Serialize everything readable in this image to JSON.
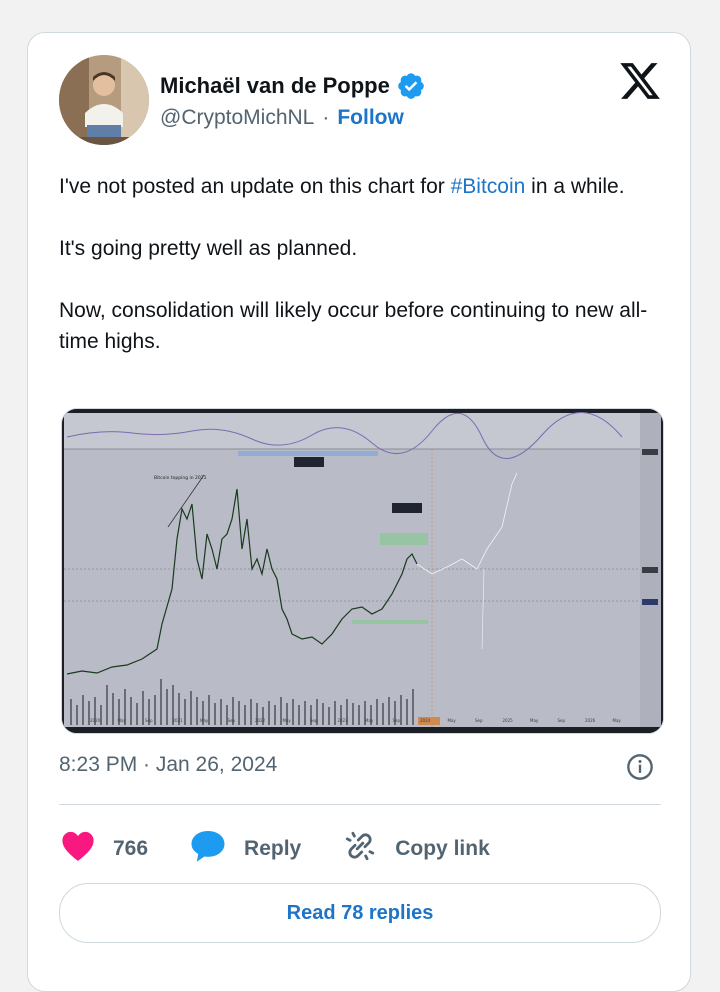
{
  "author": {
    "name": "Michaël van de Poppe",
    "handle": "@CryptoMichNL",
    "separator": "·",
    "follow_label": "Follow",
    "verified": true
  },
  "tweet": {
    "line1_prefix": "I've not posted an update on this chart for ",
    "hashtag": "#Bitcoin",
    "line1_suffix": " in a while.",
    "paragraph2": "It's going pretty well as planned.",
    "paragraph3": "Now, consolidation will likely occur before continuing to new all-time highs."
  },
  "timestamp": "8:23 PM · Jan 26, 2024",
  "actions": {
    "likes_count": "766",
    "reply_label": "Reply",
    "copy_link_label": "Copy link"
  },
  "read_replies_label": "Read 78 replies",
  "icons": {
    "brand": "x-logo-icon",
    "verified": "verified-badge-icon",
    "info": "info-icon",
    "like": "heart-icon",
    "reply": "reply-bubble-icon",
    "copy": "link-icon"
  },
  "colors": {
    "link": "#1d75c7",
    "like": "#f91880",
    "reply_icon": "#1d9bf0",
    "muted": "#536471",
    "text": "#0f1419"
  },
  "chart_image": {
    "annotation": "Bitcoin topping in 2021",
    "x_labels": [
      "2020",
      "May",
      "Sep",
      "2021",
      "May",
      "Sep",
      "2022",
      "May",
      "Sep",
      "2023",
      "May",
      "Sep",
      "2024",
      "May",
      "Sep",
      "2025",
      "May",
      "Sep",
      "2026",
      "May"
    ]
  }
}
